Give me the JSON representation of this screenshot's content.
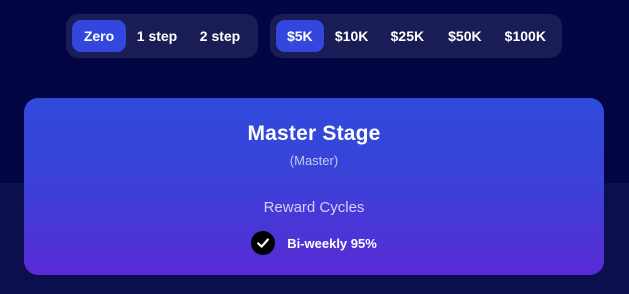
{
  "step_selector": {
    "options": [
      "Zero",
      "1 step",
      "2 step"
    ],
    "selected": "Zero"
  },
  "amount_selector": {
    "options": [
      "$5K",
      "$10K",
      "$25K",
      "$50K",
      "$100K"
    ],
    "selected": "$5K"
  },
  "stage_card": {
    "title": "Master Stage",
    "subtitle": "(Master)",
    "section_label": "Reward Cycles",
    "reward_item": "Bi-weekly 95%"
  },
  "colors": {
    "background": "#020541",
    "accent": "#3347de"
  },
  "icons": {
    "reward_check": "check-circle-icon"
  }
}
